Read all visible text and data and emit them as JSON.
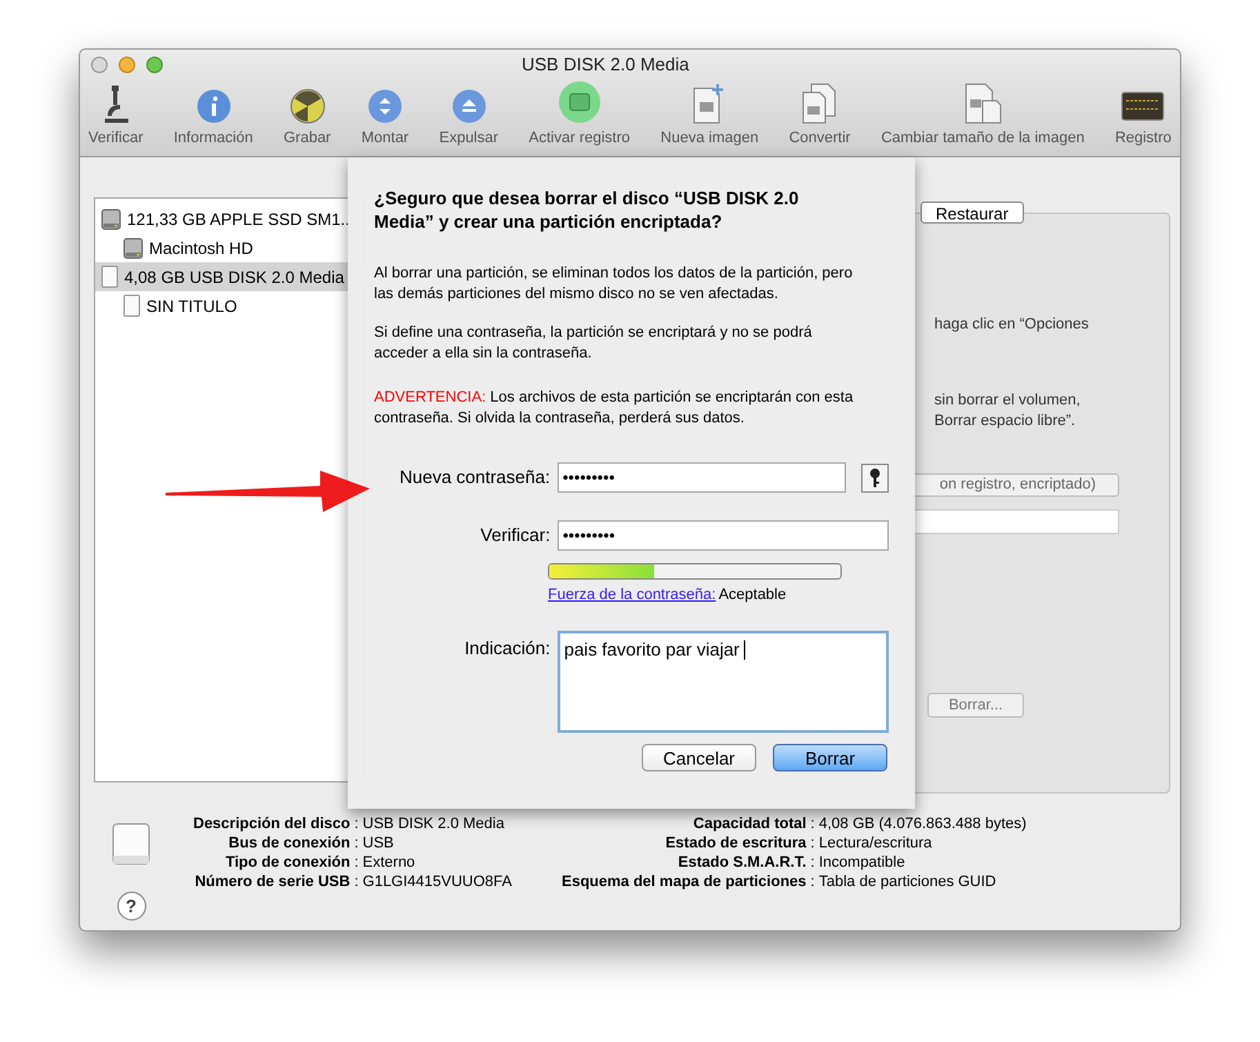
{
  "window": {
    "title": "USB DISK 2.0 Media"
  },
  "toolbar": [
    {
      "label": "Verificar",
      "kind": "microscope"
    },
    {
      "label": "Información",
      "kind": "info"
    },
    {
      "label": "Grabar",
      "kind": "burn"
    },
    {
      "label": "Montar",
      "kind": "mount"
    },
    {
      "label": "Expulsar",
      "kind": "eject"
    },
    {
      "label": "Activar registro",
      "kind": "journal"
    },
    {
      "label": "Nueva imagen",
      "kind": "newimage"
    },
    {
      "label": "Convertir",
      "kind": "convert"
    },
    {
      "label": "Cambiar tamaño de la imagen",
      "kind": "resize"
    },
    {
      "label": "Registro",
      "kind": "log"
    }
  ],
  "sidebar": {
    "items": [
      {
        "label": "121,33 GB APPLE SSD SM1...",
        "kind": "internal",
        "selected": false,
        "children": [
          {
            "label": "Macintosh HD",
            "kind": "internal",
            "selected": false
          }
        ]
      },
      {
        "label": "4,08 GB USB DISK 2.0 Media",
        "kind": "removable",
        "selected": true,
        "children": [
          {
            "label": "SIN TITULO",
            "kind": "removable",
            "selected": false
          }
        ]
      }
    ]
  },
  "background_panel": {
    "tab": "Restaurar",
    "text_lines": [
      "haga clic en “Opciones",
      "sin borrar el volumen,",
      "Borrar espacio libre”."
    ],
    "format_popup": "on registro, encriptado)",
    "button": "Borrar..."
  },
  "sheet": {
    "title": "¿Seguro que desea borrar el disco “USB DISK 2.0 Media” y crear una partición encriptada?",
    "paragraphs": [
      "Al borrar una partición, se eliminan todos los datos de la partición, pero las demás particiones del mismo disco no se ven afectadas.",
      "Si define una contraseña, la partición se encriptará y no se podrá acceder a ella sin la contraseña."
    ],
    "warning_label": "ADVERTENCIA:",
    "warning_text": "Los archivos de esta partición se encriptarán con esta contraseña. Si olvida la contraseña, perderá sus datos.",
    "password_label": "Nueva contraseña:",
    "password_value": "•••••••••",
    "verify_label": "Verificar:",
    "verify_value": "•••••••••",
    "strength": {
      "level": 0.36,
      "link": "Fuerza de la contraseña:",
      "value": "Aceptable"
    },
    "hint_label": "Indicación:",
    "hint_value": "pais favorito par viajar",
    "buttons": [
      {
        "label": "Cancelar",
        "default": false
      },
      {
        "label": "Borrar",
        "default": true
      }
    ]
  },
  "info": {
    "left": [
      {
        "label": "Descripción del disco",
        "value": "USB DISK 2.0 Media"
      },
      {
        "label": "Bus de conexión",
        "value": "USB"
      },
      {
        "label": "Tipo de conexión",
        "value": "Externo"
      },
      {
        "label": "Número de serie USB",
        "value": "G1LGI4415VUUO8FA"
      }
    ],
    "right": [
      {
        "label": "Capacidad total",
        "value": "4,08 GB (4.076.863.488 bytes)"
      },
      {
        "label": "Estado de escritura",
        "value": "Lectura/escritura"
      },
      {
        "label": "Estado S.M.A.R.T.",
        "value": "Incompatible"
      },
      {
        "label": "Esquema del mapa de particiones",
        "value": "Tabla de particiones GUID"
      }
    ]
  },
  "separator": ":",
  "help_button": "?"
}
